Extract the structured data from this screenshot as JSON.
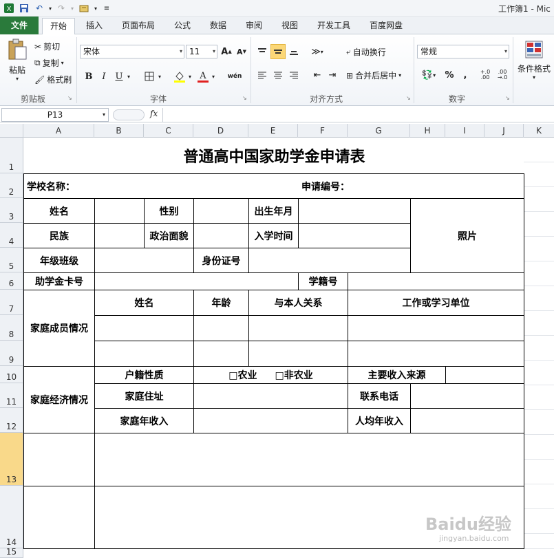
{
  "window": {
    "title": "工作簿1 - Mic"
  },
  "tabs": [
    {
      "label": "文件"
    },
    {
      "label": "开始"
    },
    {
      "label": "插入"
    },
    {
      "label": "页面布局"
    },
    {
      "label": "公式"
    },
    {
      "label": "数据"
    },
    {
      "label": "审阅"
    },
    {
      "label": "视图"
    },
    {
      "label": "开发工具"
    },
    {
      "label": "百度网盘"
    }
  ],
  "ribbon": {
    "clipboard": {
      "paste": "粘贴",
      "cut": "剪切",
      "copy": "复制",
      "format_painter": "格式刷",
      "label": "剪贴板"
    },
    "font": {
      "name": "宋体",
      "size": "11",
      "label": "字体",
      "grow": "A",
      "shrink": "A",
      "bold": "B",
      "italic": "I",
      "underline": "U",
      "wen": "wén"
    },
    "alignment": {
      "wrap": "自动换行",
      "merge": "合并后居中",
      "label": "对齐方式"
    },
    "number": {
      "format": "常规",
      "percent": "%",
      "comma": ",",
      "inc": "+.0 .00",
      "dec": ".00 →.0",
      "label": "数字"
    },
    "styles": {
      "conditional": "条件格式"
    }
  },
  "formula_bar": {
    "name_box": "P13",
    "fx": "fx"
  },
  "sheet": {
    "columns": [
      "A",
      "B",
      "C",
      "D",
      "E",
      "F",
      "G",
      "H",
      "I",
      "J",
      "K"
    ],
    "rows": [
      "1",
      "2",
      "3",
      "4",
      "5",
      "6",
      "7",
      "8",
      "9",
      "10",
      "11",
      "12",
      "13",
      "14",
      "15"
    ],
    "active_row": "13"
  },
  "form": {
    "title": "普通高中国家助学金申请表",
    "school_name": "学校名称：",
    "app_number": "申请编号：",
    "name": "姓名",
    "gender": "性别",
    "birth": "出生年月",
    "photo": "照片",
    "ethnicity": "民族",
    "politics": "政治面貌",
    "enroll": "入学时间",
    "grade_class": "年级班级",
    "id_number": "身份证号",
    "card_number": "助学金卡号",
    "student_no": "学籍号",
    "family_members": "家庭成员情况",
    "member_name": "姓名",
    "member_age": "年龄",
    "member_relation": "与本人关系",
    "member_work": "工作或学习单位",
    "family_economy": "家庭经济情况",
    "household_type": "户籍性质",
    "agri": "□农业",
    "non_agri": "□非农业",
    "income_source": "主要收入来源",
    "address": "家庭住址",
    "phone": "联系电话",
    "annual_income": "家庭年收入",
    "per_capita": "人均年收入"
  },
  "watermark": {
    "brand": "Baidu经验",
    "url": "jingyan.baidu.com"
  },
  "colors": {
    "file_tab": "#2a7a3b",
    "active_row": "#f9d98a",
    "highlight_btn": "#fbd777"
  }
}
